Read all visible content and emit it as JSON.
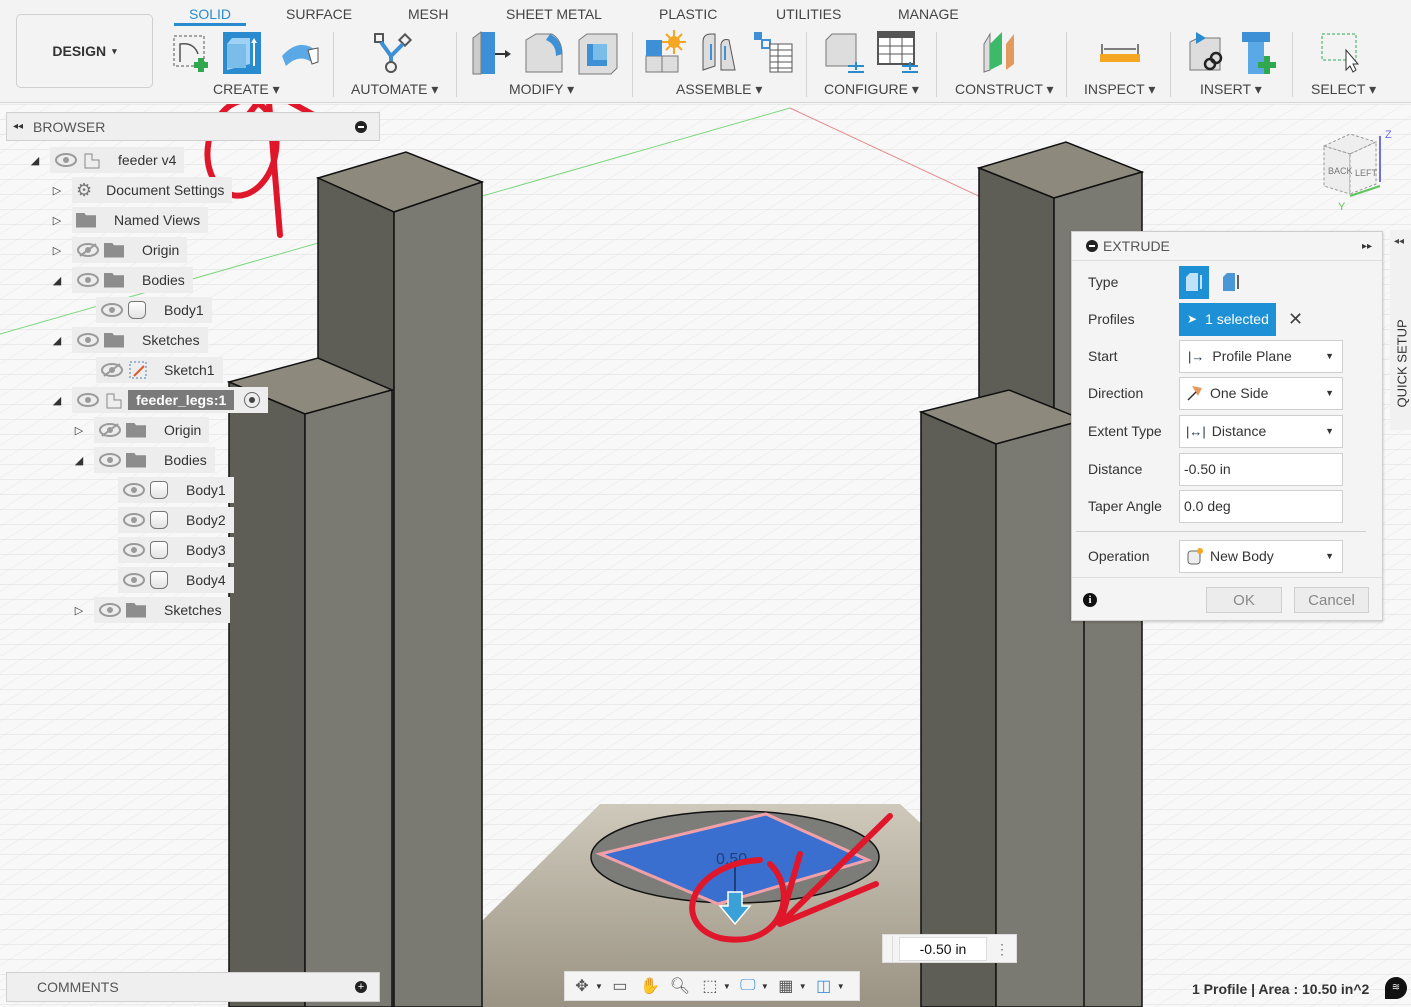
{
  "workspace": {
    "label": "DESIGN",
    "caret": "▾"
  },
  "tabs": [
    {
      "label": "SOLID",
      "active": true
    },
    {
      "label": "SURFACE"
    },
    {
      "label": "MESH"
    },
    {
      "label": "SHEET METAL"
    },
    {
      "label": "PLASTIC"
    },
    {
      "label": "UTILITIES"
    },
    {
      "label": "MANAGE"
    }
  ],
  "groups": {
    "create": "CREATE ▾",
    "automate": "AUTOMATE ▾",
    "modify": "MODIFY ▾",
    "assemble": "ASSEMBLE ▾",
    "configure": "CONFIGURE ▾",
    "construct": "CONSTRUCT ▾",
    "inspect": "INSPECT ▾",
    "insert": "INSERT ▾",
    "select": "SELECT ▾"
  },
  "browser": {
    "title": "BROWSER",
    "items": [
      {
        "label": "feeder v4",
        "icon": "component-icon",
        "expanded": true
      },
      {
        "label": "Document Settings",
        "icon": "gear-icon"
      },
      {
        "label": "Named Views",
        "icon": "folder-icon"
      },
      {
        "label": "Origin",
        "icon": "folder-icon",
        "hidden": true
      },
      {
        "label": "Bodies",
        "icon": "folder-icon",
        "expanded": true
      },
      {
        "label": "Body1",
        "icon": "body-icon"
      },
      {
        "label": "Sketches",
        "icon": "folder-icon",
        "expanded": true
      },
      {
        "label": "Sketch1",
        "icon": "sketch-icon",
        "hidden": true
      },
      {
        "label": "feeder_legs:1",
        "icon": "component-icon",
        "active": true
      },
      {
        "label": "Origin",
        "icon": "folder-icon",
        "hidden": true
      },
      {
        "label": "Bodies",
        "icon": "folder-icon",
        "expanded": true
      },
      {
        "label": "Body1",
        "icon": "body-icon"
      },
      {
        "label": "Body2",
        "icon": "body-icon"
      },
      {
        "label": "Body3",
        "icon": "body-icon"
      },
      {
        "label": "Body4",
        "icon": "body-icon"
      },
      {
        "label": "Sketches",
        "icon": "folder-icon"
      }
    ]
  },
  "comments": {
    "title": "COMMENTS"
  },
  "viewcube": {
    "faces": [
      "BACK",
      "LEFT"
    ],
    "axis_z": "Z",
    "axis_y": "Y"
  },
  "extrude": {
    "title": "EXTRUDE",
    "type_label": "Type",
    "profiles_label": "Profiles",
    "profiles_value": "1 selected",
    "start_label": "Start",
    "start_value": "Profile Plane",
    "direction_label": "Direction",
    "direction_value": "One Side",
    "extent_label": "Extent Type",
    "extent_value": "Distance",
    "distance_label": "Distance",
    "distance_value": "-0.50 in",
    "taper_label": "Taper Angle",
    "taper_value": "0.0 deg",
    "operation_label": "Operation",
    "operation_value": "New Body",
    "ok": "OK",
    "cancel": "Cancel"
  },
  "quick_setup": "QUICK SETUP",
  "distance_input": "-0.50 in",
  "manipulator_label": "0.50",
  "status": "1 Profile | Area : 10.50 in^2",
  "colors": {
    "accent": "#2a8ccf",
    "selection": "#1e90d6",
    "profile_fill": "#3a6fd0",
    "annotation": "#e0162b"
  }
}
